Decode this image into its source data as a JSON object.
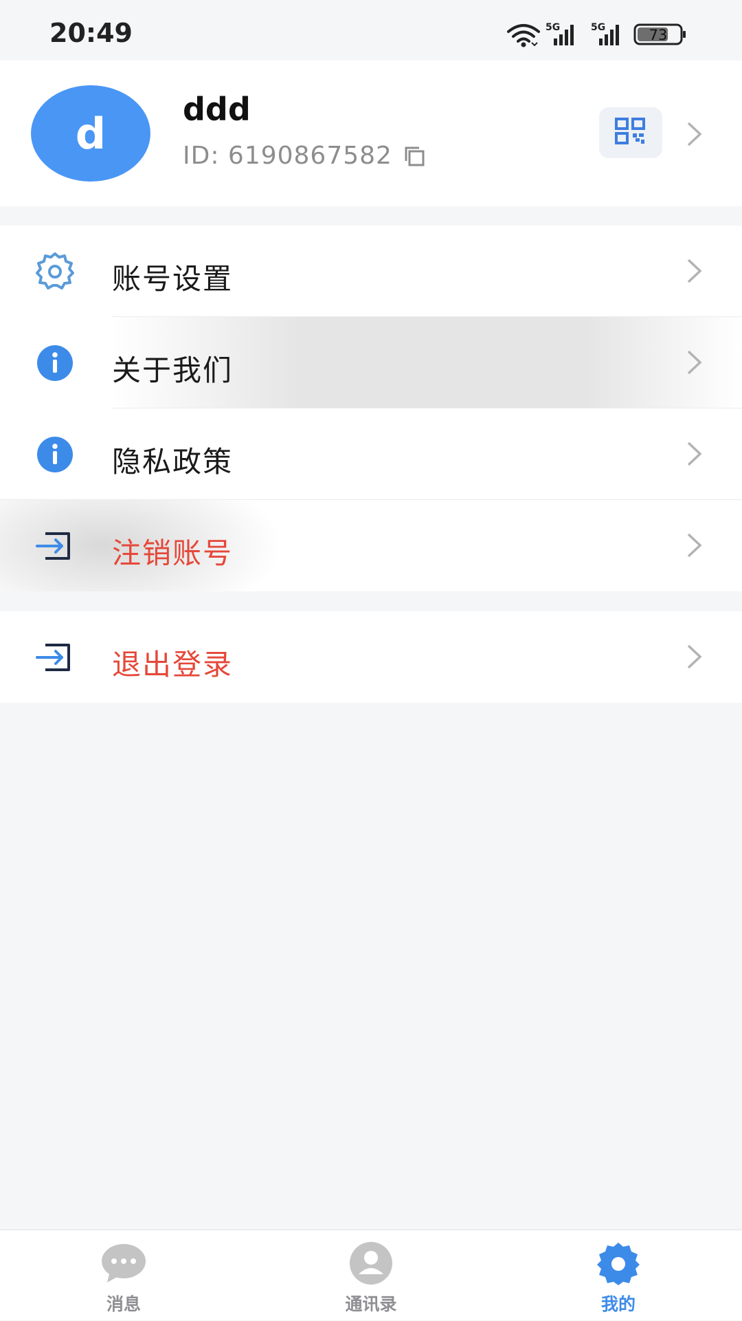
{
  "status_bar": {
    "time": "20:49",
    "network_1": "5G",
    "network_2": "5G",
    "battery": "73"
  },
  "profile": {
    "avatar_letter": "d",
    "name": "ddd",
    "id_text": "ID: 6190867582",
    "icons": [
      "copy-icon",
      "qr-code-icon",
      "chevron-right-icon"
    ]
  },
  "menu": {
    "account_settings": "账号设置",
    "about_us": "关于我们",
    "privacy_policy": "隐私政策",
    "deactivate_account": "注销账号",
    "logout": "退出登录"
  },
  "tabs": {
    "messages": "消息",
    "contacts": "通讯录",
    "mine": "我的"
  },
  "colors": {
    "accent": "#3D8BE8",
    "avatar": "#4A96F5",
    "danger": "#E5483A",
    "inactive_tab": "#8E8E93",
    "background": "#F5F6F8"
  }
}
